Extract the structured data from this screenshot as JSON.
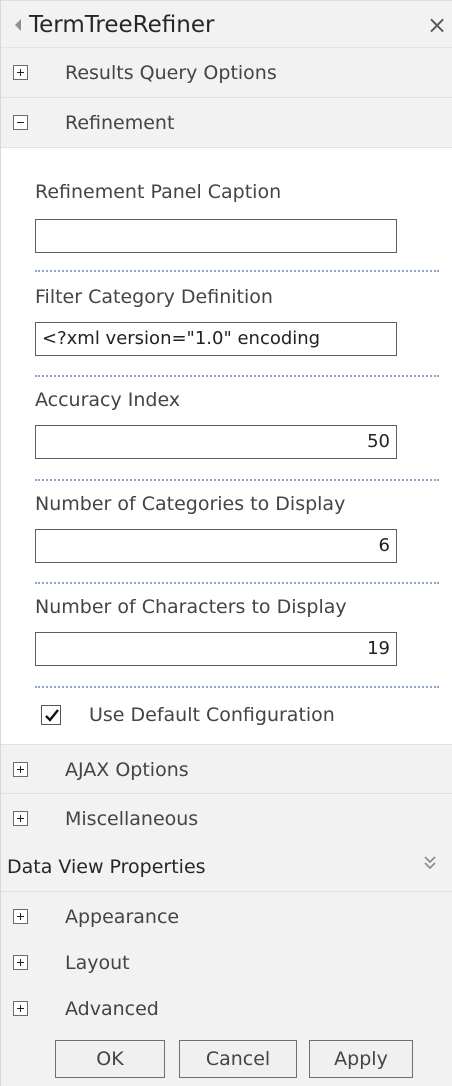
{
  "panel": {
    "title": "TermTreeRefiner",
    "close_symbol": "×",
    "icons": {
      "collapse": "triangle-left-icon",
      "close": "close-icon",
      "expand": "plus-box-icon",
      "collapse_section": "minus-box-icon",
      "section_toggle": "double-chevron-down-icon",
      "check": "checkmark-icon"
    }
  },
  "sections": {
    "results_query_options": "Results Query Options",
    "refinement": "Refinement",
    "ajax_options": "AJAX Options",
    "miscellaneous": "Miscellaneous",
    "data_view_properties": "Data View Properties",
    "appearance": "Appearance",
    "layout": "Layout",
    "advanced": "Advanced"
  },
  "refinement": {
    "caption_label": "Refinement Panel Caption",
    "caption_value": "",
    "filter_label": "Filter Category Definition",
    "filter_value": "<?xml version=\"1.0\" encoding",
    "accuracy_label": "Accuracy Index",
    "accuracy_value": "50",
    "categories_label": "Number of Categories to Display",
    "categories_value": "6",
    "characters_label": "Number of Characters to Display",
    "characters_value": "19",
    "use_default_label": "Use Default Configuration",
    "use_default_checked": true
  },
  "buttons": {
    "ok": "OK",
    "cancel": "Cancel",
    "apply": "Apply"
  },
  "colors": {
    "header_bg": "#f2f2f2",
    "divider": "#8ea6cc",
    "text": "#444444"
  }
}
